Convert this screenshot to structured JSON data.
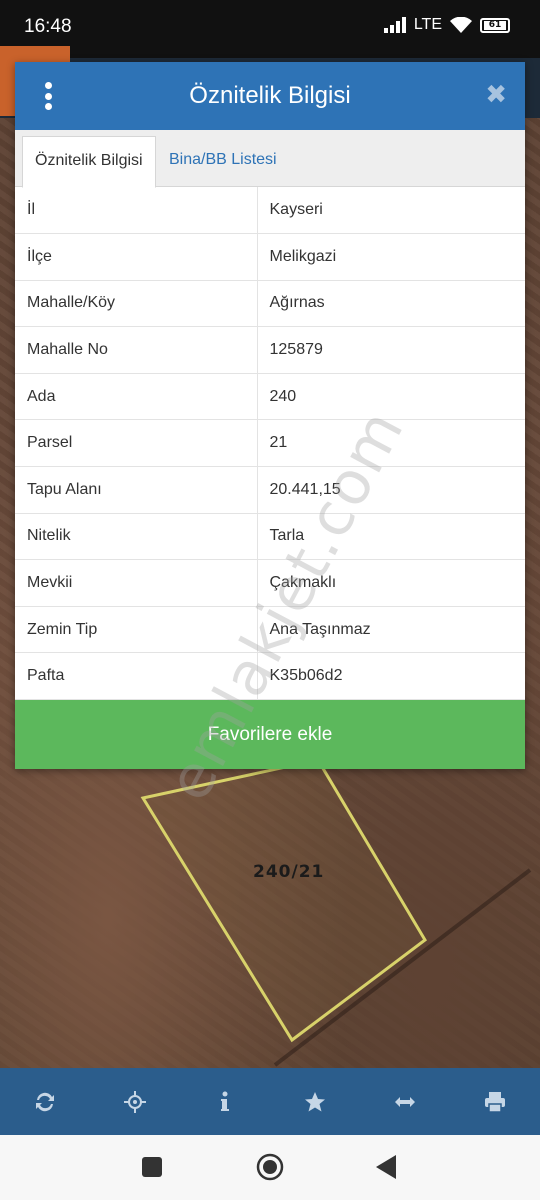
{
  "status_bar": {
    "time": "16:48",
    "network": "LTE",
    "battery": "61"
  },
  "dialog": {
    "title": "Öznitelik Bilgisi",
    "tabs": [
      {
        "label": "Öznitelik Bilgisi"
      },
      {
        "label": "Bina/BB Listesi"
      }
    ],
    "rows": [
      {
        "key": "İl",
        "value": "Kayseri"
      },
      {
        "key": "İlçe",
        "value": "Melikgazi"
      },
      {
        "key": "Mahalle/Köy",
        "value": "Ağırnas"
      },
      {
        "key": "Mahalle No",
        "value": "125879"
      },
      {
        "key": "Ada",
        "value": "240"
      },
      {
        "key": "Parsel",
        "value": "21"
      },
      {
        "key": "Tapu Alanı",
        "value": "20.441,15"
      },
      {
        "key": "Nitelik",
        "value": "Tarla"
      },
      {
        "key": "Mevkii",
        "value": "Çakmaklı"
      },
      {
        "key": "Zemin Tip",
        "value": "Ana Taşınmaz"
      },
      {
        "key": "Pafta",
        "value": "K35b06d2"
      }
    ],
    "favorite_button": "Favorilere ekle"
  },
  "map": {
    "parcel_label": "240/21",
    "watermark": "emlakjet.com"
  },
  "toolbar_icons": [
    "refresh-icon",
    "locate-icon",
    "info-icon",
    "star-icon",
    "measure-icon",
    "print-icon"
  ],
  "colors": {
    "header": "#2e73b6",
    "toolbar": "#2b5d8c",
    "favorite_button": "#5cb85c",
    "parcel_outline": "#d8d26a"
  }
}
